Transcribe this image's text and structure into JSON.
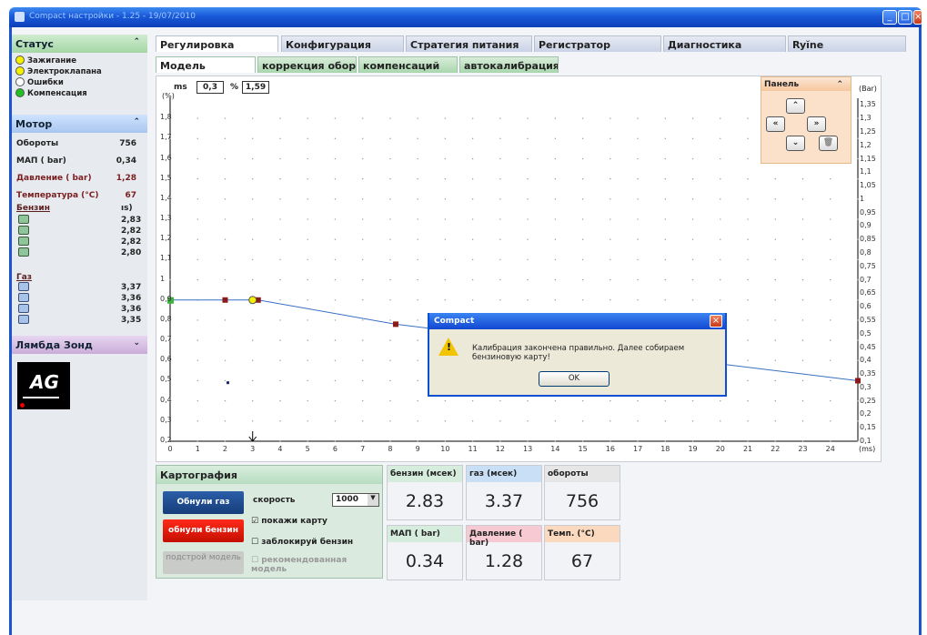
{
  "window": {
    "title": "Compact настройки - 1.25 - 19/07/2010"
  },
  "status": {
    "title": "Статус",
    "items": [
      {
        "label": "Зажигание",
        "color": "#f4f000"
      },
      {
        "label": "Электроклапана",
        "color": "#f4f000"
      },
      {
        "label": "Ошибки",
        "color": "#ffffff"
      },
      {
        "label": "Компенсация",
        "color": "#22c022"
      }
    ]
  },
  "motor": {
    "title": "Мотор",
    "rows": [
      {
        "label": "Обороты",
        "value": "756"
      },
      {
        "label": "МАП  ( bar)",
        "value": "0,34"
      },
      {
        "label": "Давление  ( bar)",
        "value": "1,28"
      },
      {
        "label": "Температура  (°C)",
        "value": "67"
      }
    ],
    "petrol_label": "Бензин",
    "petrol_unit": "ıs)",
    "petrol_values": [
      "2,83",
      "2,82",
      "2,82",
      "2,80"
    ],
    "gas_label": "Газ",
    "gas_values": [
      "3,37",
      "3,36",
      "3,36",
      "3,35"
    ]
  },
  "lambda": {
    "title": "Лямбда Зонд"
  },
  "tabs": [
    "Регулировка",
    "Конфигурация",
    "Стратегия питания",
    "Регистратор",
    "Диагностика",
    "Ryĭne"
  ],
  "subtabs": [
    "Модель",
    "коррекция оборотов",
    "компенсаций",
    "автокалибрация"
  ],
  "chart_header": {
    "ms_label": "ms",
    "ms_value": "0,3",
    "pct_label": "%",
    "pct_value": "1,59"
  },
  "chart_data": {
    "type": "line",
    "left_axis_unit": "(%)",
    "right_axis_unit": "(Bar)",
    "x_unit": "(ms)",
    "xlim": [
      0,
      25
    ],
    "ylim": [
      0.2,
      1.9
    ],
    "right_ylim": [
      0.1,
      1.375
    ],
    "x_ticks": [
      "0",
      "1",
      "2",
      "3",
      "4",
      "5",
      "6",
      "7",
      "8",
      "9",
      "10",
      "11",
      "12",
      "13",
      "14",
      "15",
      "16",
      "17",
      "18",
      "19",
      "20",
      "21",
      "22",
      "23",
      "24"
    ],
    "y_ticks": [
      "0,2",
      "0,3",
      "0,4",
      "0,5",
      "0,6",
      "0,7",
      "0,8",
      "0,9",
      "1",
      "1,1",
      "1,2",
      "1,3",
      "1,4",
      "1,5",
      "1,6",
      "1,7",
      "1,8"
    ],
    "right_ticks": [
      "0,1",
      "0,15",
      "0,2",
      "0,25",
      "0,3",
      "0,35",
      "0,4",
      "0,45",
      "0,5",
      "0,55",
      "0,6",
      "0,65",
      "0,7",
      "0,75",
      "0,8",
      "0,85",
      "0,9",
      "0,95",
      "1",
      "1,05",
      "1,1",
      "1,15",
      "1,2",
      "1,25",
      "1,3",
      "1,35"
    ],
    "series": [
      {
        "x": [
          0,
          2,
          3,
          3.2,
          8.2,
          25
        ],
        "y": [
          0.9,
          0.9,
          0.9,
          0.9,
          0.78,
          0.5
        ]
      }
    ],
    "stray_point": {
      "x": 2.1,
      "y": 0.49
    },
    "marker_x": 3
  },
  "panel": {
    "title": "Панель"
  },
  "dialog": {
    "title": "Compact",
    "message": "Калибрация закончена правильно. Далее собираем бензиновую карту!",
    "ok": "OK"
  },
  "cartography": {
    "title": "Картография",
    "reset_gas": "Обнули газ",
    "reset_petrol": "обнули бензин",
    "adjust_model": "подстрой модель",
    "speed_label": "скорость",
    "speed_value": "1000",
    "show_map": "покажи карту",
    "lock_petrol": "заблокируй бензин",
    "recommended": "рекомендованная модель"
  },
  "tiles": [
    {
      "label": "бензин  (мсек)",
      "value": "2.83",
      "color": "#d6ecdc"
    },
    {
      "label": "газ  (мсек)",
      "value": "3.37",
      "color": "#c9dff5"
    },
    {
      "label": "обороты",
      "value": "756",
      "color": "#e6e6e6"
    },
    {
      "label": "МАП  ( bar)",
      "value": "0.34",
      "color": "#d6ecdc"
    },
    {
      "label": "Давление  ( bar)",
      "value": "1.28",
      "color": "#f7c9d2"
    },
    {
      "label": "Темп.  (°C)",
      "value": "67",
      "color": "#fbd9bf"
    }
  ]
}
